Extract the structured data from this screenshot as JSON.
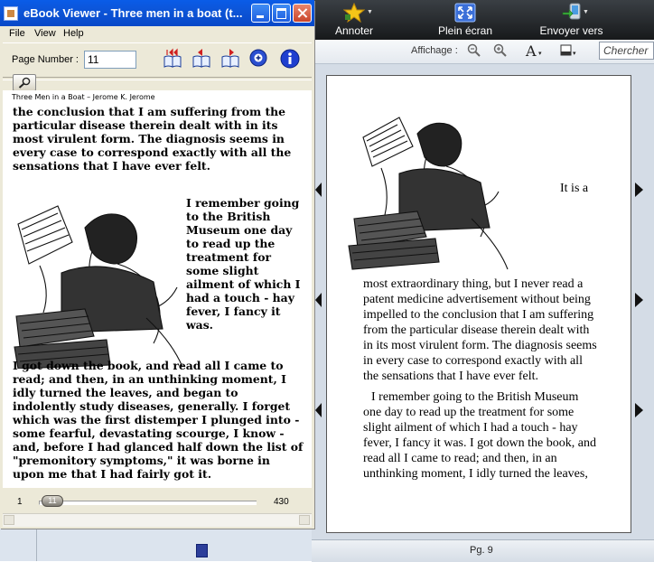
{
  "reader_app": {
    "toolbar": {
      "annotate_label": "Annoter",
      "fullscreen_label": "Plein écran",
      "send_to_label": "Envoyer vers"
    },
    "display_label": "Affichage :",
    "search_placeholder": "Chercher",
    "inline_start": "It is a",
    "paragraph1": "most extraordinary thing, but I never read a patent medicine advertisement without being impelled to the conclusion that I am suffering from the particular disease therein dealt with in its most virulent form. The diagnosis seems in every case to correspond exactly with all the sensations that I have ever felt.",
    "paragraph2": "I remember going to the British Museum one day to read up the treatment for some slight ailment of which I had a touch - hay fever, I fancy it was. I got down the book, and read all I came to read; and then, in an unthinking moment, I idly turned the leaves,",
    "page_status": "Pg. 9",
    "colors": {
      "toolbar": "#1e2124",
      "status_marker": "#2c3e9a",
      "page_bg": "#ffffff"
    }
  },
  "ebook_viewer": {
    "title": "eBook Viewer - Three men in a boat (t...",
    "menu": [
      "File",
      "View",
      "Help"
    ],
    "page_number_label": "Page Number :",
    "page_number_value": "11",
    "tool_icons": [
      "first-page-icon",
      "previous-page-icon",
      "next-page-icon",
      "zoom-icon",
      "info-icon"
    ],
    "running_header": "Three Men in a Boat – Jerome K. Jerome",
    "paragraph1": "the conclusion that I am suffering from the particular disease therein dealt with in its most virulent form. The diagnosis seems in every case to correspond exactly with all the sensations that I have ever felt.",
    "float_text": " I remember going to the British Museum one day to read up the treatment for some slight ailment of which I had a touch - hay fever, I fancy it was.",
    "paragraph3_start": "I got down the book, and read all I came to read; and then, in an unthinking moment, I idly turned the leaves, and began to indolently study diseases, generally. I forget which was the first distemper I plunged into - some fearful, devastating scourge, I know - and, before I had glanced half down the list of \"premonitory symptoms,\" it was borne in upon me that I had fairly got it.",
    "slider": {
      "min": "1",
      "max": "430",
      "current": "11",
      "current_fraction": 0.023
    },
    "colors": {
      "titlebar": "#0c55d8",
      "window_bg": "#ece9d8"
    }
  }
}
